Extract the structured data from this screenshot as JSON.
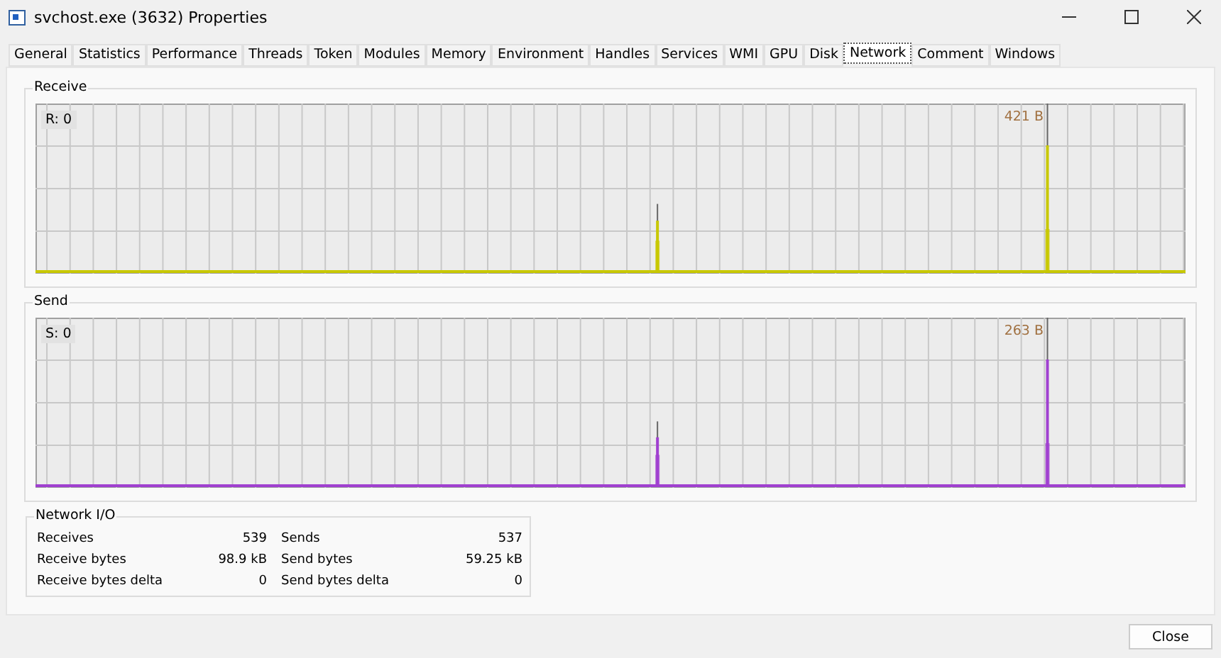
{
  "window": {
    "title": "svchost.exe (3632) Properties"
  },
  "tabs": [
    {
      "label": "General",
      "selected": false
    },
    {
      "label": "Statistics",
      "selected": false
    },
    {
      "label": "Performance",
      "selected": false
    },
    {
      "label": "Threads",
      "selected": false
    },
    {
      "label": "Token",
      "selected": false
    },
    {
      "label": "Modules",
      "selected": false
    },
    {
      "label": "Memory",
      "selected": false
    },
    {
      "label": "Environment",
      "selected": false
    },
    {
      "label": "Handles",
      "selected": false
    },
    {
      "label": "Services",
      "selected": false
    },
    {
      "label": "WMI",
      "selected": false
    },
    {
      "label": "GPU",
      "selected": false
    },
    {
      "label": "Disk",
      "selected": false
    },
    {
      "label": "Network",
      "selected": true
    },
    {
      "label": "Comment",
      "selected": false
    },
    {
      "label": "Windows",
      "selected": false
    }
  ],
  "graphs": [
    {
      "title": "Receive",
      "current": "R: 0",
      "peak": "421 B",
      "color": "#c8c800"
    },
    {
      "title": "Send",
      "current": "S: 0",
      "peak": "263 B",
      "color": "#a040d0"
    }
  ],
  "network_io": {
    "title": "Network I/O",
    "rows": [
      {
        "label": "Receives",
        "value": "539",
        "label_2": "Sends",
        "value_2": "537"
      },
      {
        "label": "Receive bytes",
        "value": "98.9 kB",
        "label_2": "Send bytes",
        "value_2": "59.25 kB"
      },
      {
        "label": "Receive bytes delta",
        "value": "0",
        "label_2": "Send bytes delta",
        "value_2": "0"
      }
    ]
  },
  "buttons": [
    "Close"
  ]
}
